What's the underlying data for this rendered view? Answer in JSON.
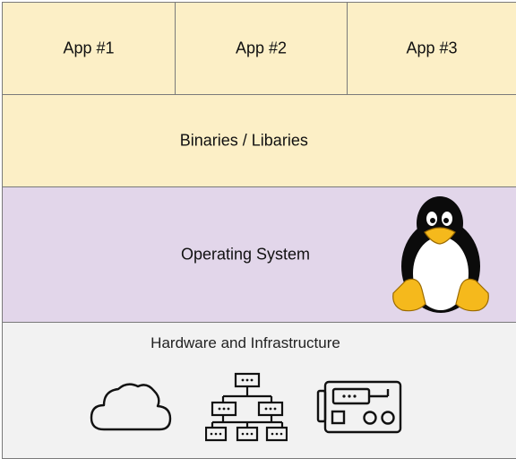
{
  "colors": {
    "app_fill": "#fcefc6",
    "binaries_fill": "#fcefc6",
    "os_fill": "#e2d6ea",
    "hardware_fill": "#f2f2f2",
    "border": "#7a7a7a",
    "tux_yellow": "#f5b91c"
  },
  "apps": [
    {
      "label": "App #1"
    },
    {
      "label": "App #2"
    },
    {
      "label": "App #3"
    }
  ],
  "binaries": {
    "label": "Binaries / Libaries"
  },
  "operating_system": {
    "label": "Operating System",
    "icon": "tux-penguin-icon"
  },
  "hardware": {
    "label": "Hardware and Infrastructure",
    "icons": [
      "cloud-icon",
      "network-hierarchy-icon",
      "server-device-icon"
    ]
  }
}
